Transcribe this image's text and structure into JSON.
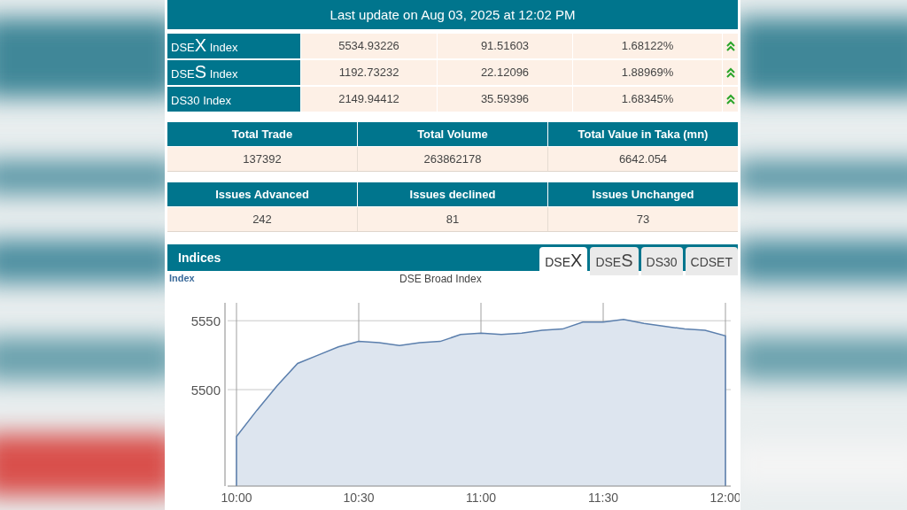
{
  "header": {
    "title": "Last update on Aug 03, 2025 at 12:02 PM"
  },
  "indices": [
    {
      "prefix": "DSE",
      "big": "X",
      "rest": " Index",
      "value": "5534.93226",
      "change": "91.51603",
      "percent": "1.68122%"
    },
    {
      "prefix": "DSE",
      "big": "S",
      "rest": " Index",
      "value": "1192.73232",
      "change": "22.12096",
      "percent": "1.88969%"
    },
    {
      "prefix": "DS30 Index",
      "value": "2149.94412",
      "change": "35.59396",
      "percent": "1.68345%"
    }
  ],
  "trade_table": {
    "columns": [
      "Total Trade",
      "Total Volume",
      "Total Value in Taka (mn)"
    ],
    "values": [
      "137392",
      "263862178",
      "6642.054"
    ]
  },
  "issues_table": {
    "columns": [
      "Issues Advanced",
      "Issues declined",
      "Issues Unchanged"
    ],
    "values": [
      "242",
      "81",
      "73"
    ]
  },
  "indices_panel": {
    "title": "Indices",
    "tabs": [
      {
        "prefix": "DSE",
        "big": "X",
        "selected": true
      },
      {
        "prefix": "DSE",
        "big": "S",
        "selected": false
      },
      {
        "prefix": "DS30",
        "selected": false
      },
      {
        "prefix": "CDSET",
        "selected": false
      }
    ],
    "chart_data": {
      "type": "area",
      "title": "DSE Broad Index",
      "ylabel": "Index",
      "categories": [
        "10:00",
        null,
        null,
        null,
        null,
        null,
        "10:30",
        null,
        null,
        null,
        null,
        null,
        "11:00",
        null,
        null,
        null,
        null,
        null,
        "11:30",
        null,
        null,
        null,
        null,
        null,
        "12:00"
      ],
      "series": [
        {
          "color": "#5b7fad",
          "values": [
            5466,
            5485,
            5503,
            5519,
            5525,
            5531,
            5535,
            5534,
            5532,
            5534,
            5535,
            5540,
            5541,
            5540,
            5541,
            5543,
            5544,
            5549,
            5549,
            5551,
            5548,
            5546,
            5544,
            5543,
            5539
          ]
        }
      ],
      "ylim": [
        5430,
        5563
      ],
      "yticks": [
        5500,
        5550
      ],
      "grid": true
    }
  }
}
